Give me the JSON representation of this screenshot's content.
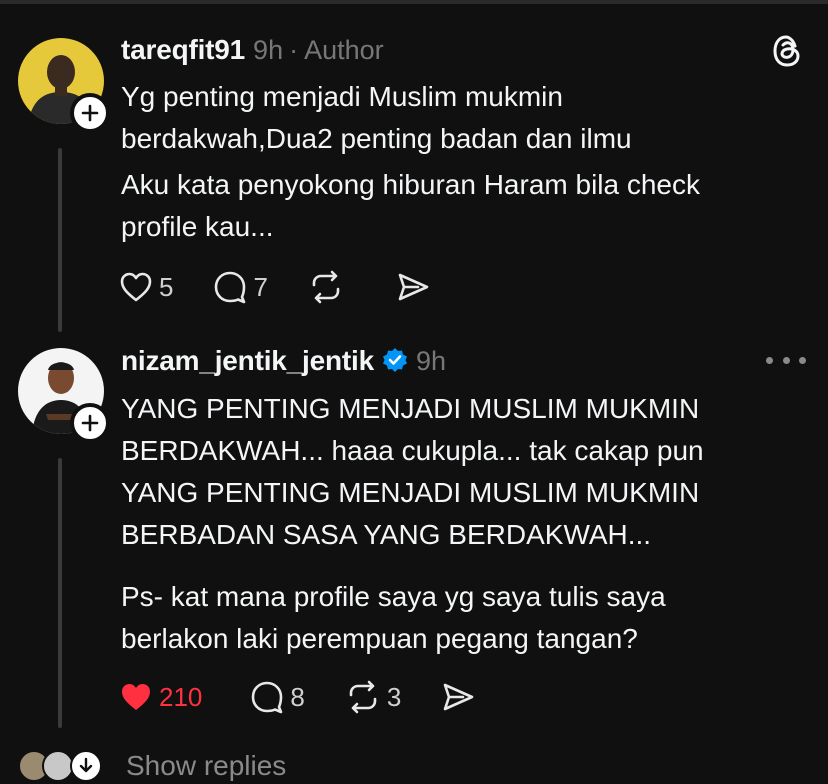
{
  "posts": [
    {
      "username": "tareqfit91",
      "time": "9h",
      "role": "Author",
      "lines": [
        "Yg penting menjadi Muslim mukmin",
        "berdakwah,Dua2 penting badan dan ilmu"
      ],
      "lines2": [
        "Aku kata penyokong hiburan Haram bila  check",
        "profile kau..."
      ],
      "likes": "5",
      "comments": "7",
      "reposts": "",
      "liked": false
    },
    {
      "username": "nizam_jentik_jentik",
      "verified": true,
      "time": "9h",
      "lines": [
        "YANG PENTING MENJADI MUSLIM MUKMIN",
        "BERDAKWAH... haaa cukupla... tak cakap pun",
        "YANG PENTING MENJADI MUSLIM MUKMIN",
        "BERBADAN SASA YANG BERDAKWAH..."
      ],
      "lines2": [
        "Ps- kat mana profile saya yg saya tulis saya",
        "berlakon laki perempuan pegang tangan?"
      ],
      "likes": "210",
      "comments": "8",
      "reposts": "3",
      "liked": true
    }
  ],
  "show_replies_label": "Show replies",
  "colors": {
    "background": "#101010",
    "text": "#f3f5f7",
    "muted": "#777777",
    "like_red": "#ff3040",
    "verified_blue": "#0095f6"
  },
  "icons": [
    "heart-icon",
    "comment-icon",
    "repost-icon",
    "share-icon",
    "threads-logo-icon",
    "more-icon",
    "plus-icon",
    "verified-icon",
    "chevron-down-icon"
  ]
}
